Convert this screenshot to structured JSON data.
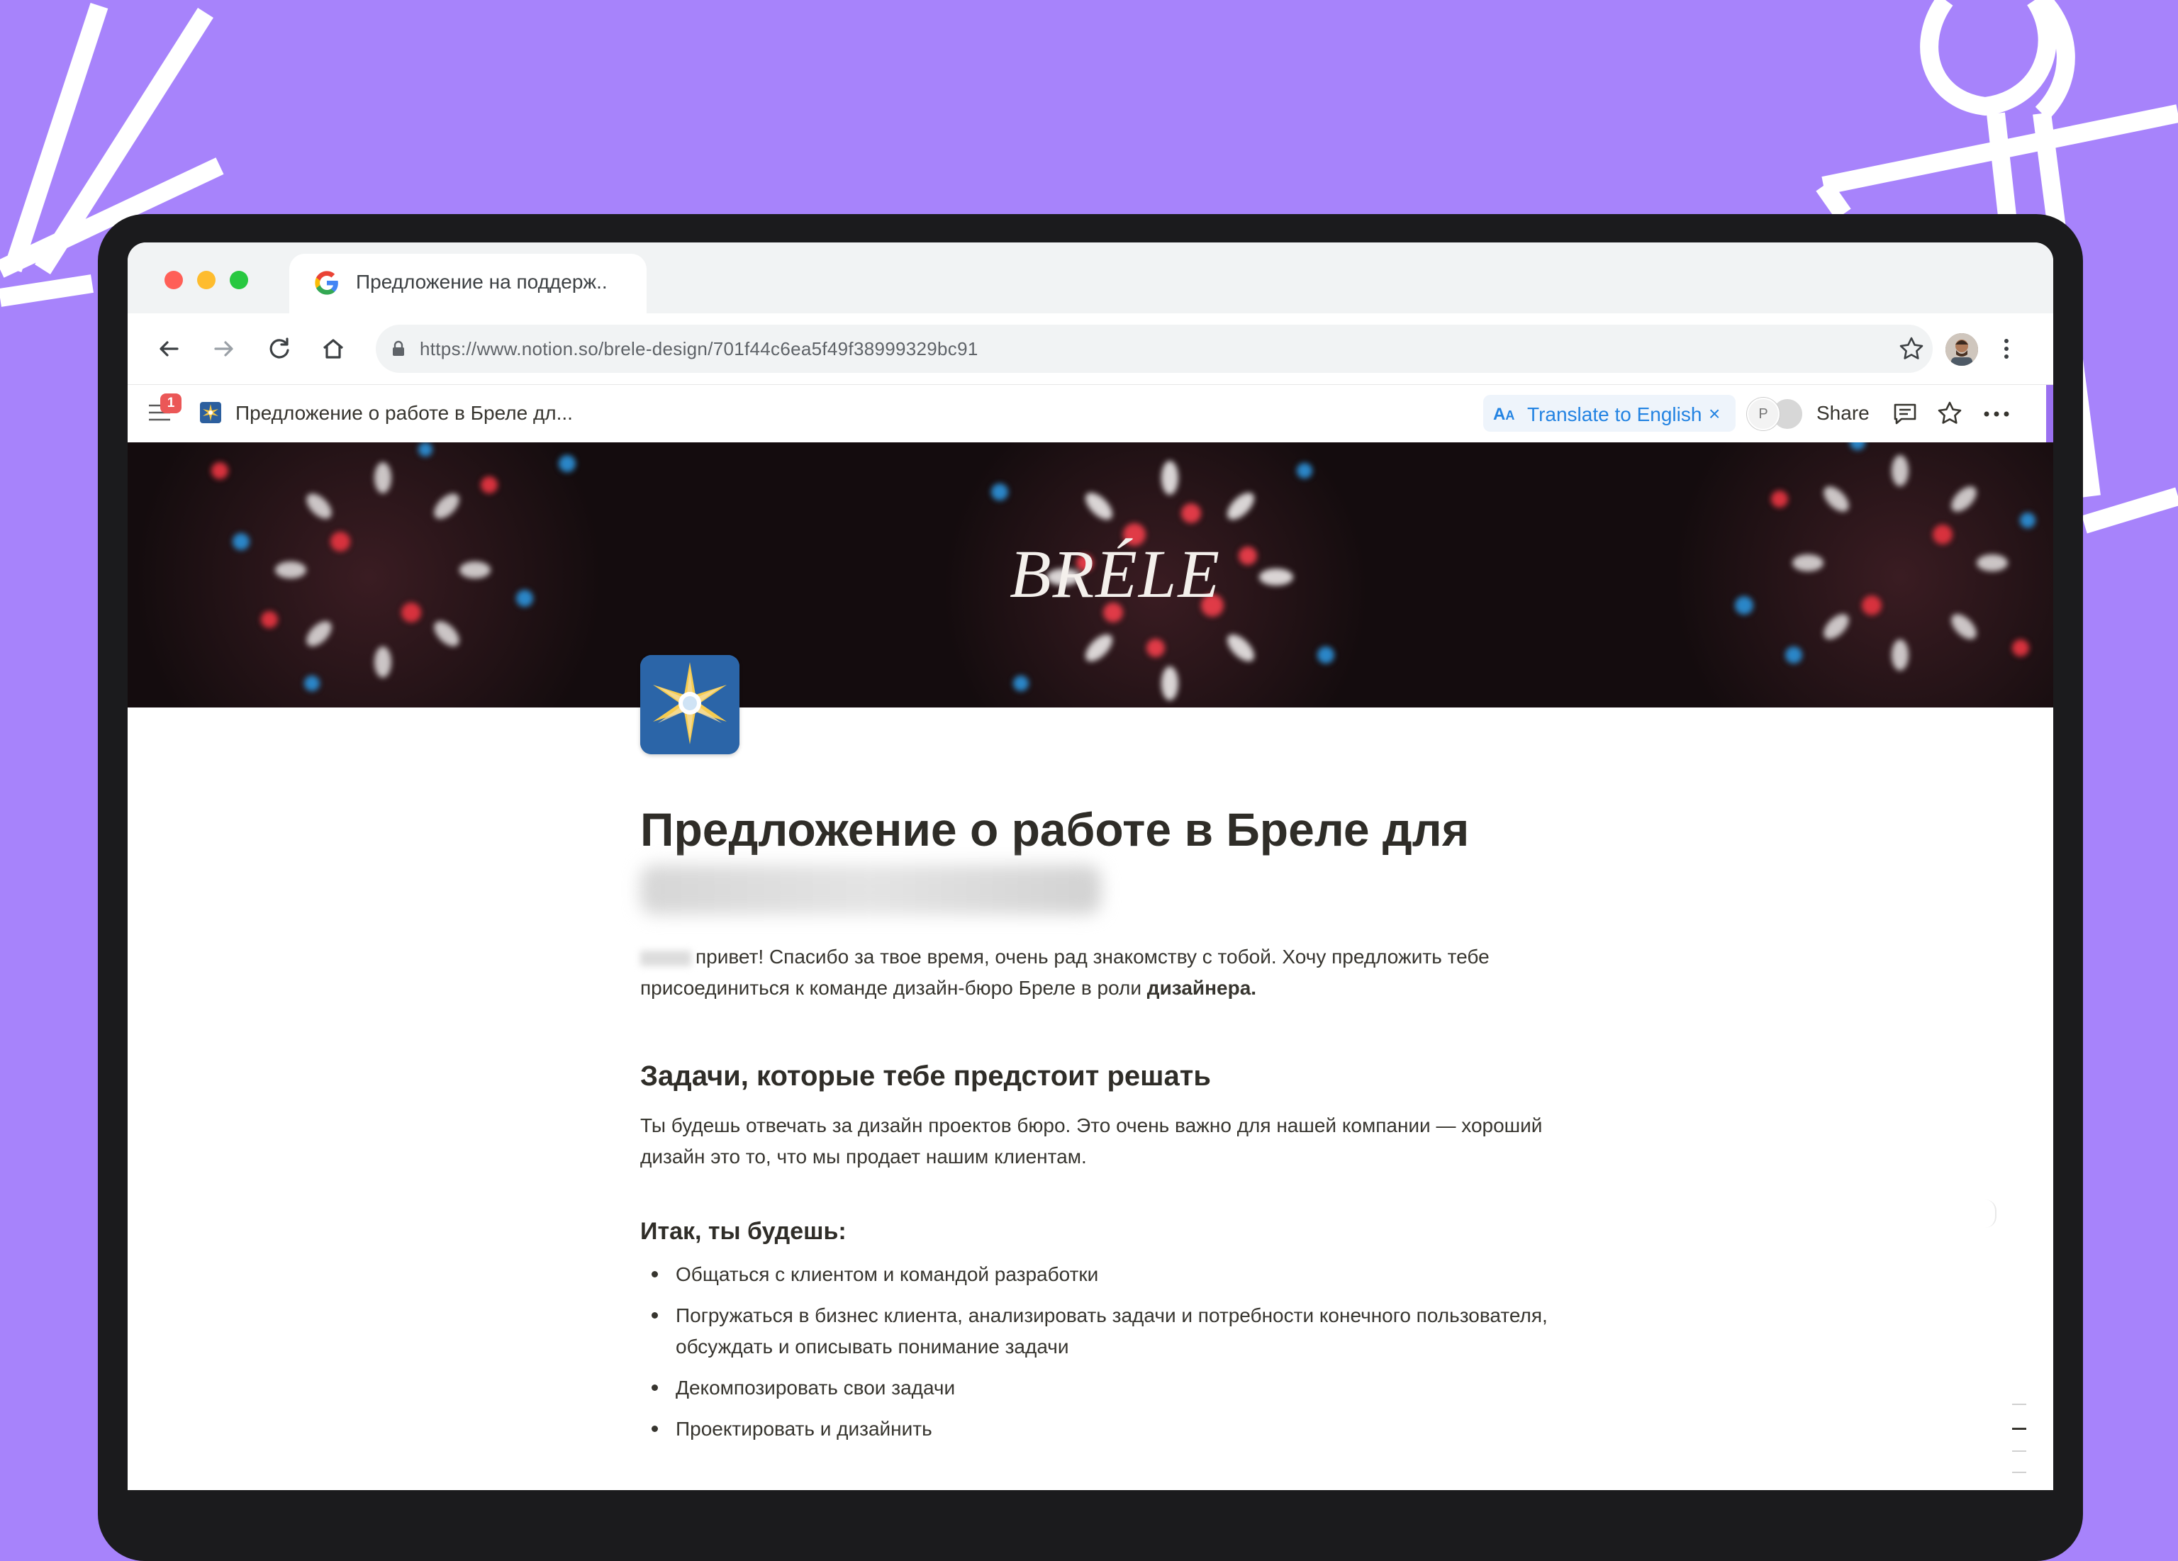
{
  "colors": {
    "background": "#a783fb",
    "accent": "#2383e2",
    "badge": "#eb5757"
  },
  "browser": {
    "tab": {
      "title": "Предложение на поддерж..",
      "favicon": "google-g-icon"
    },
    "url": "https://www.notion.so/brele-design/701f44c6ea5f49f38999329bc91",
    "profile": "profile-avatar"
  },
  "notion_bar": {
    "notification_count": "1",
    "page_title": "Предложение о работе в Бреле дл...",
    "translate_icon": "A",
    "translate_label": "Translate to English",
    "presence_initial": "P",
    "share_label": "Share"
  },
  "cover": {
    "logo_text": "BRÉLE"
  },
  "page": {
    "title": "Предложение о работе в Бреле для",
    "intro_text": "привет! Спасибо за твое время, очень рад знакомству с тобой. Хочу предложить тебе присоединиться к команде дизайн-бюро Бреле в роли ",
    "intro_bold": "дизайнера.",
    "section_heading": "Задачи, которые тебе предстоит решать",
    "section_text": "Ты будешь отвечать за дизайн проектов бюро. Это очень важно для нашей компании — хороший дизайн это то, что мы продает нашим клиентам.",
    "subheading": "Итак, ты будешь:",
    "bullets": [
      "Общаться с клиентом и командой разработки",
      "Погружаться в бизнес клиента, анализировать задачи и потребности конечного пользователя, обсуждать и описывать понимание задачи",
      "Декомпозировать свои задачи",
      "Проектировать и дизайнить"
    ]
  }
}
